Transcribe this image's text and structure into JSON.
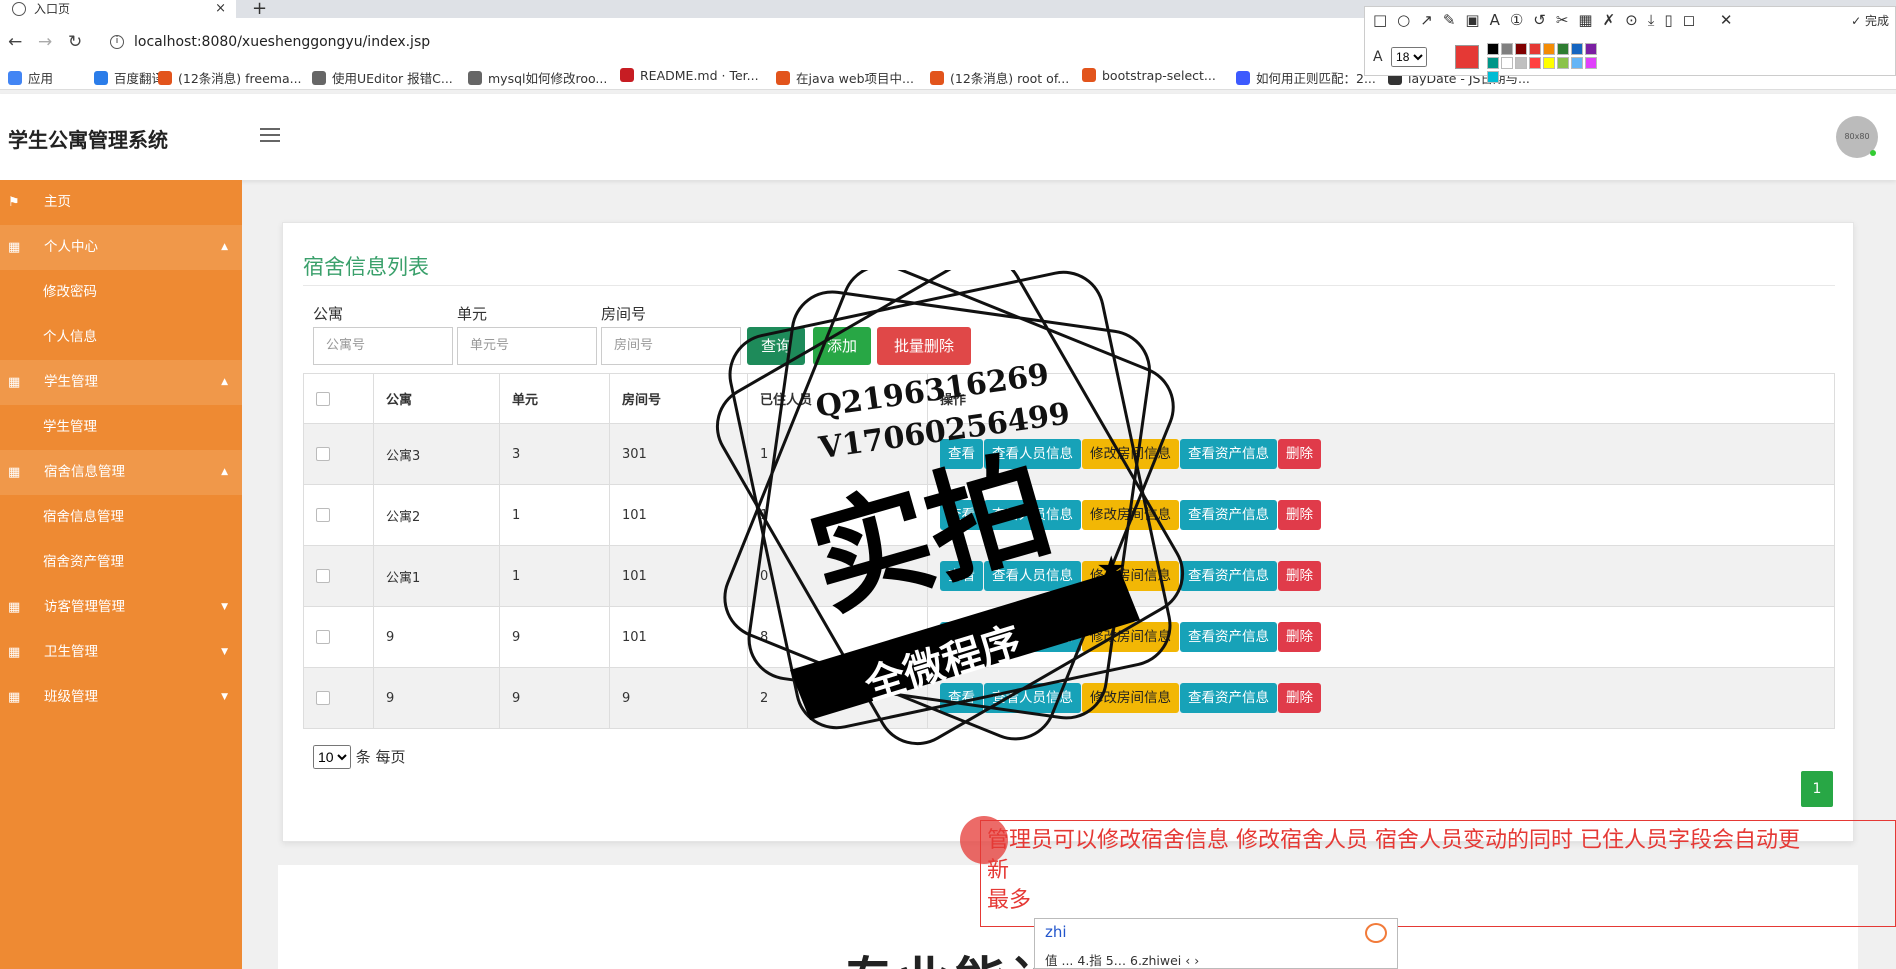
{
  "browser": {
    "tab_title": "入口页",
    "tab_close": "×",
    "new_tab": "+",
    "url": "localhost:8080/xueshenggongyu/index.jsp",
    "bookmarks": [
      {
        "label": "应用",
        "color": "#4285f4"
      },
      {
        "label": "百度翻译",
        "color": "#2b7de9"
      },
      {
        "label": "(12条消息) freema...",
        "color": "#e2541c"
      },
      {
        "label": "使用UEditor 报错C...",
        "color": "#666666"
      },
      {
        "label": "mysql如何修改roo...",
        "color": "#666666"
      },
      {
        "label": "README.md · Ter...",
        "color": "#c71d23"
      },
      {
        "label": "在java web项目中...",
        "color": "#e2541c"
      },
      {
        "label": "(12条消息) root of...",
        "color": "#e2541c"
      },
      {
        "label": "bootstrap-select...",
        "color": "#e2541c"
      },
      {
        "label": "如何用正则匹配：2...",
        "color": "#3d5afe"
      },
      {
        "label": "layDate - JS日期与...",
        "color": "#333333"
      }
    ]
  },
  "snap_toolbar": {
    "tools": "□○↗✎▣A①↺✂▦✗⊙⤓▯◻ ✕",
    "done_label": "✓ 完成",
    "font_icon": "A",
    "font_size": "18",
    "current_color": "#e53935",
    "palette": [
      "#000000",
      "#808080",
      "#800000",
      "#e53935",
      "#f48c06",
      "#2e7d32",
      "#1565c0",
      "#7b1fa2",
      "#009688",
      "#ffffff",
      "#c0c0c0",
      "#ff4040",
      "#ffff00",
      "#8bc34a",
      "#64b5f6",
      "#e040fb",
      "#00bcd4"
    ]
  },
  "header": {
    "brand": "学生公寓管理系统",
    "avatar_text": "80x80"
  },
  "sidebar": {
    "items": [
      {
        "label": "主页",
        "icon": "⚑",
        "kind": "top"
      },
      {
        "label": "个人中心",
        "icon": "▦",
        "kind": "group",
        "caret": "▲"
      },
      {
        "label": "修改密码",
        "icon": "",
        "kind": "sub"
      },
      {
        "label": "个人信息",
        "icon": "",
        "kind": "sub"
      },
      {
        "label": "学生管理",
        "icon": "▦",
        "kind": "group",
        "caret": "▲"
      },
      {
        "label": "学生管理",
        "icon": "",
        "kind": "sub"
      },
      {
        "label": "宿舍信息管理",
        "icon": "▦",
        "kind": "group",
        "caret": "▲"
      },
      {
        "label": "宿舍信息管理",
        "icon": "",
        "kind": "sub"
      },
      {
        "label": "宿舍资产管理",
        "icon": "",
        "kind": "sub"
      },
      {
        "label": "访客管理管理",
        "icon": "▦",
        "kind": "top",
        "caret": "▼"
      },
      {
        "label": "卫生管理",
        "icon": "▦",
        "kind": "top",
        "caret": "▼"
      },
      {
        "label": "班级管理",
        "icon": "▦",
        "kind": "top",
        "caret": "▼"
      }
    ]
  },
  "main": {
    "title": "宿舍信息列表",
    "filters": [
      {
        "label": "公寓",
        "placeholder": "公寓号"
      },
      {
        "label": "单元",
        "placeholder": "单元号"
      },
      {
        "label": "房间号",
        "placeholder": "房间号"
      }
    ],
    "buttons": {
      "query": "查询",
      "add": "添加",
      "batch_delete": "批量删除"
    },
    "table": {
      "headers": [
        "公寓",
        "单元",
        "房间号",
        "已住人员",
        "操作"
      ],
      "rows": [
        [
          "公寓3",
          "3",
          "301",
          "1"
        ],
        [
          "公寓2",
          "1",
          "101",
          "1"
        ],
        [
          "公寓1",
          "1",
          "101",
          "0"
        ],
        [
          "9",
          "9",
          "101",
          "8"
        ],
        [
          "9",
          "9",
          "9",
          "2"
        ]
      ],
      "actions": [
        "查看",
        "查看人员信息",
        "修改房间信息",
        "查看资产信息",
        "删除"
      ]
    },
    "page_size": "10",
    "page_size_suffix": "条 每页",
    "current_page": "1",
    "big_text": "专业能设计"
  },
  "watermark": {
    "line1": "Q2196316269",
    "line2": "V17060256499",
    "big": "实拍",
    "ribbon": "全微程序"
  },
  "annotation": {
    "line1": "管理员可以修改宿舍信息  修改宿舍人员  宿舍人员变动的同时  已住人员字段会自动更",
    "line2": "新",
    "line3": "最多"
  },
  "ime": {
    "composition": "zhi",
    "candidates": "值   ... 4.指  5.‥  6.zhiwei   ‹  ›"
  }
}
